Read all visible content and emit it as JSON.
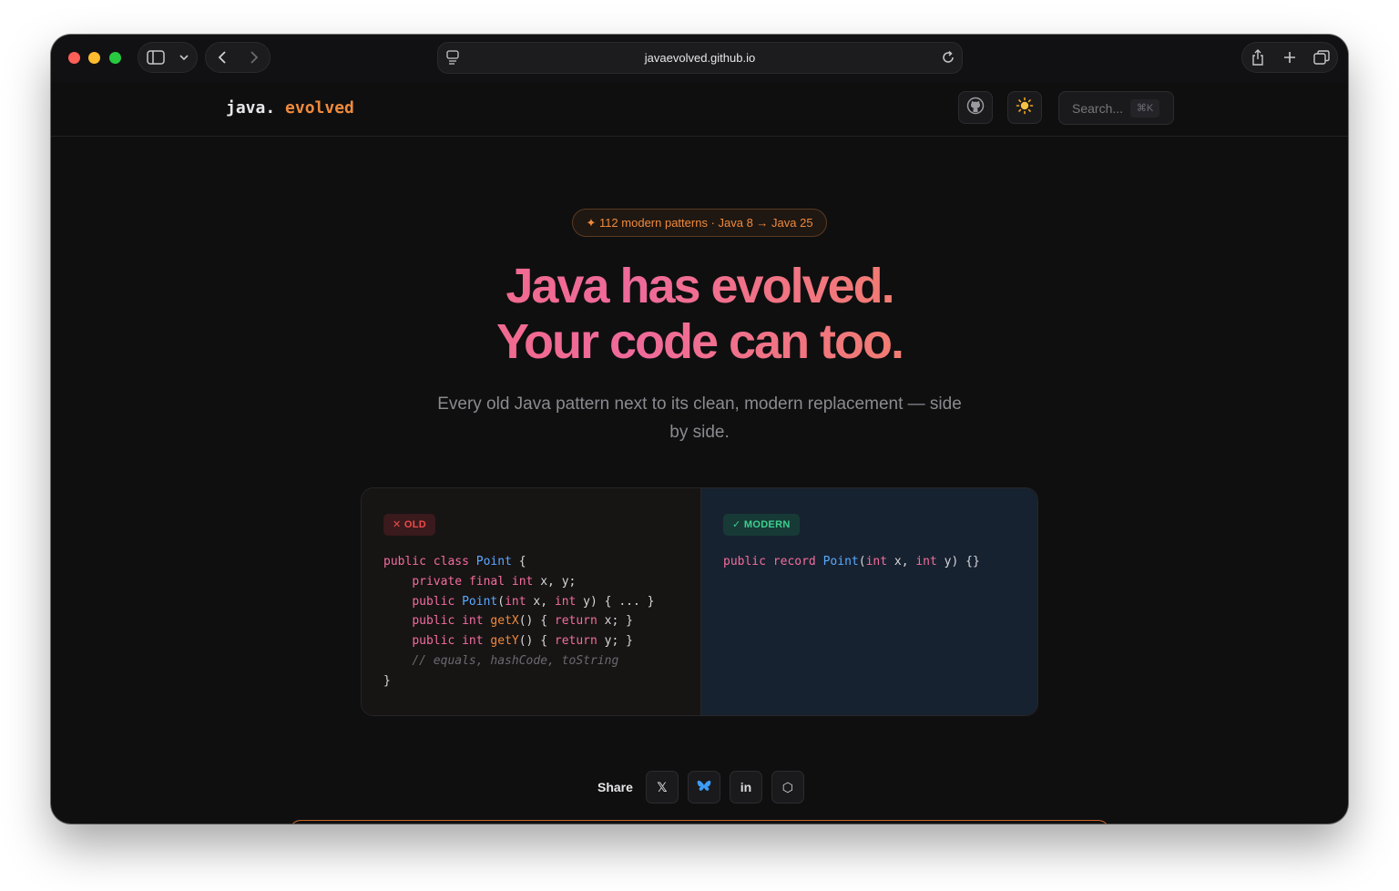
{
  "browser": {
    "url": "javaevolved.github.io"
  },
  "header": {
    "logo_part1": "java.",
    "logo_part2": "evolved",
    "search_placeholder": "Search...",
    "search_shortcut": "⌘K"
  },
  "hero": {
    "badge": "✦ 112 modern patterns · Java 8 → Java 25",
    "title_line1": "Java has evolved.",
    "title_line2": "Your code can too.",
    "subtitle": "Every old Java pattern next to its clean, modern replacement — side by side."
  },
  "comparison": {
    "old_label": "✕ OLD",
    "modern_label": "✓ MODERN"
  },
  "share": {
    "label": "Share",
    "x_glyph": "𝕏",
    "bluesky_glyph": "🦋",
    "linkedin_glyph": "in",
    "copy_glyph": "⬡"
  },
  "colors": {
    "accent": "#f08a3c",
    "keyword": "#f26d9e",
    "type": "#5aa9ff",
    "old_tag": "#ef4a4a",
    "modern_tag": "#3ecf8e"
  }
}
